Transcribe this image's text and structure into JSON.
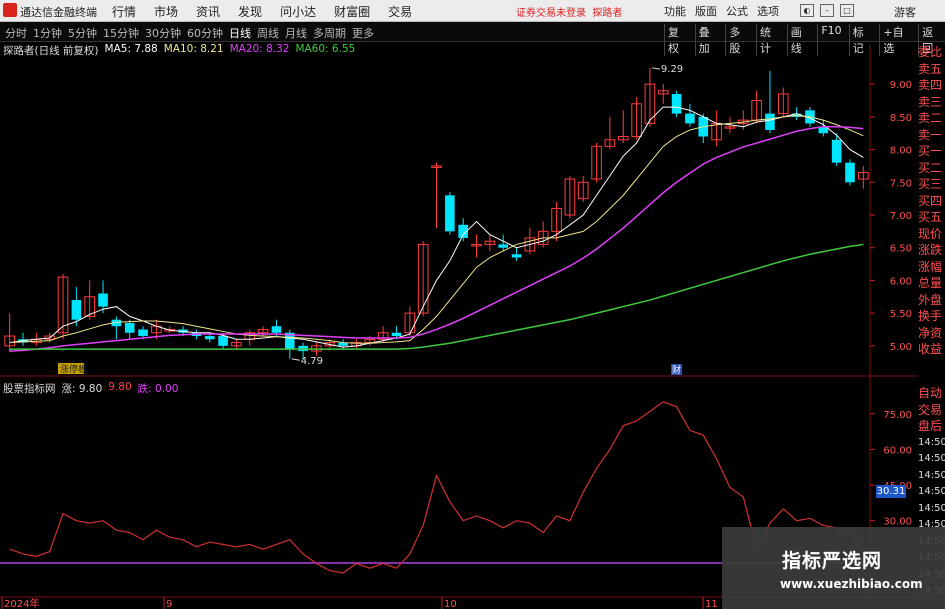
{
  "topbar": {
    "app_name": "通达信金融终端",
    "menu": [
      "行情",
      "市场",
      "资讯",
      "发现",
      "问小达",
      "财富圈",
      "交易"
    ],
    "warning": "证券交易未登录",
    "account": "探路者",
    "right_menu": [
      "功能",
      "版面",
      "公式",
      "选项"
    ],
    "guest": "游客"
  },
  "periods": {
    "items": [
      "分时",
      "1分钟",
      "5分钟",
      "15分钟",
      "30分钟",
      "60分钟",
      "日线",
      "周线",
      "月线",
      "多周期",
      "更多"
    ],
    "selected": "日线"
  },
  "tools": [
    "复权",
    "叠加",
    "多股",
    "统计",
    "画线",
    "F10",
    "标记",
    "+自选",
    "返回"
  ],
  "upper": {
    "stock_label": "探路者(日线 前复权)",
    "ma5": "MA5: 7.88",
    "ma10": "MA10: 8.21",
    "ma20": "MA20: 8.32",
    "ma60": "MA60: 6.55",
    "high_label": "9.29",
    "low_label": "4.79",
    "tag_left": "涨停板",
    "tag_mid": "财",
    "colors": {
      "up": "#ff3c3c",
      "down": "#00e5ff",
      "ma5": "#ffffff",
      "ma10": "#f0e68c",
      "ma20": "#e040fb",
      "ma60": "#3ec93e"
    }
  },
  "lower": {
    "title": "股票指标网",
    "zhang": "涨: 9.80",
    "val2": "9.80",
    "die": "跌: 0.00",
    "current_label": "30.31"
  },
  "side_panel": [
    "委比",
    "卖五",
    "卖四",
    "卖三",
    "卖二",
    "卖一",
    "买一",
    "买二",
    "买三",
    "买四",
    "买五",
    "现价",
    "涨跌",
    "涨幅",
    "总量",
    "外盘",
    "换手",
    "净资",
    "收益"
  ],
  "side_panel2": [
    "自动",
    "交易",
    "盘后",
    "14:50",
    "14:50",
    "14:50",
    "14:50",
    "14:50",
    "14:50",
    "14:50",
    "14:50",
    "14:50",
    "14:50"
  ],
  "watermark": {
    "line1": "指标严选网",
    "line2": "www.xuezhibiao.com"
  },
  "chart_data": [
    {
      "type": "candlestick",
      "y_ticks": [
        5.0,
        5.5,
        6.0,
        6.5,
        7.0,
        7.5,
        8.0,
        8.5,
        9.0
      ],
      "ylim": [
        4.6,
        9.4
      ],
      "x_tick_labels": [
        "2024年",
        "9",
        "10",
        "11"
      ],
      "candles": [
        [
          5.0,
          5.15,
          5.5,
          4.9
        ],
        [
          5.1,
          5.05,
          5.2,
          5.0
        ],
        [
          5.05,
          5.1,
          5.2,
          5.0
        ],
        [
          5.1,
          5.15,
          5.2,
          5.05
        ],
        [
          5.2,
          6.05,
          6.1,
          5.1
        ],
        [
          5.7,
          5.4,
          5.9,
          5.3
        ],
        [
          5.45,
          5.75,
          6.0,
          5.4
        ],
        [
          5.8,
          5.6,
          6.0,
          5.5
        ],
        [
          5.4,
          5.3,
          5.45,
          5.1
        ],
        [
          5.35,
          5.2,
          5.4,
          5.1
        ],
        [
          5.25,
          5.15,
          5.3,
          5.1
        ],
        [
          5.2,
          5.3,
          5.4,
          5.1
        ],
        [
          5.25,
          5.25,
          5.3,
          5.2
        ],
        [
          5.25,
          5.2,
          5.3,
          5.15
        ],
        [
          5.2,
          5.15,
          5.25,
          5.1
        ],
        [
          5.15,
          5.1,
          5.2,
          5.05
        ],
        [
          5.15,
          5.0,
          5.2,
          4.95
        ],
        [
          5.0,
          5.05,
          5.1,
          4.95
        ],
        [
          5.1,
          5.2,
          5.25,
          5.0
        ],
        [
          5.2,
          5.25,
          5.3,
          5.15
        ],
        [
          5.3,
          5.2,
          5.4,
          5.15
        ],
        [
          5.2,
          4.95,
          5.25,
          4.8
        ],
        [
          5.0,
          4.92,
          5.05,
          4.8
        ],
        [
          4.92,
          5.0,
          5.05,
          4.85
        ],
        [
          5.0,
          5.05,
          5.1,
          4.95
        ],
        [
          5.05,
          5.0,
          5.1,
          4.95
        ],
        [
          5.0,
          5.05,
          5.1,
          4.95
        ],
        [
          5.05,
          5.1,
          5.15,
          5.0
        ],
        [
          5.1,
          5.2,
          5.3,
          5.05
        ],
        [
          5.2,
          5.15,
          5.3,
          5.1
        ],
        [
          5.2,
          5.5,
          5.6,
          5.15
        ],
        [
          5.5,
          6.55,
          6.6,
          5.45
        ],
        [
          7.75,
          7.75,
          7.8,
          6.8
        ],
        [
          7.3,
          6.75,
          7.35,
          6.7
        ],
        [
          6.85,
          6.65,
          6.95,
          6.6
        ],
        [
          6.55,
          6.55,
          6.7,
          6.35
        ],
        [
          6.55,
          6.6,
          6.7,
          6.45
        ],
        [
          6.55,
          6.5,
          6.7,
          6.45
        ],
        [
          6.4,
          6.35,
          6.5,
          6.3
        ],
        [
          6.45,
          6.65,
          6.8,
          6.4
        ],
        [
          6.55,
          6.75,
          6.9,
          6.5
        ],
        [
          6.75,
          7.1,
          7.2,
          6.6
        ],
        [
          7.0,
          7.55,
          7.6,
          6.95
        ],
        [
          7.25,
          7.5,
          7.6,
          7.2
        ],
        [
          7.55,
          8.05,
          8.1,
          7.5
        ],
        [
          8.05,
          8.15,
          8.5,
          8.0
        ],
        [
          8.15,
          8.2,
          8.6,
          8.1
        ],
        [
          8.2,
          8.7,
          8.8,
          8.15
        ],
        [
          8.4,
          9.0,
          9.25,
          8.35
        ],
        [
          8.85,
          8.9,
          9.0,
          8.7
        ],
        [
          8.85,
          8.55,
          8.9,
          8.5
        ],
        [
          8.55,
          8.4,
          8.7,
          8.35
        ],
        [
          8.5,
          8.2,
          8.55,
          8.1
        ],
        [
          8.15,
          8.4,
          8.6,
          8.05
        ],
        [
          8.35,
          8.35,
          8.5,
          8.25
        ],
        [
          8.4,
          8.45,
          8.6,
          8.3
        ],
        [
          8.45,
          8.75,
          8.9,
          8.4
        ],
        [
          8.55,
          8.3,
          9.2,
          8.25
        ],
        [
          8.55,
          8.85,
          8.95,
          8.5
        ],
        [
          8.55,
          8.5,
          8.65,
          8.45
        ],
        [
          8.6,
          8.4,
          8.65,
          8.35
        ],
        [
          8.35,
          8.25,
          8.45,
          8.2
        ],
        [
          8.15,
          7.8,
          8.25,
          7.75
        ],
        [
          7.8,
          7.5,
          7.85,
          7.45
        ],
        [
          7.55,
          7.65,
          7.75,
          7.4
        ]
      ],
      "ma_series": [
        {
          "name": "MA5",
          "values": [
            5.05,
            5.08,
            5.1,
            5.12,
            5.3,
            5.37,
            5.48,
            5.56,
            5.6,
            5.45,
            5.38,
            5.3,
            5.24,
            5.22,
            5.2,
            5.2,
            5.16,
            5.1,
            5.1,
            5.12,
            5.14,
            5.12,
            5.1,
            5.06,
            5.02,
            4.98,
            5.0,
            5.04,
            5.08,
            5.12,
            5.18,
            5.6,
            6.0,
            6.3,
            6.7,
            6.9,
            6.7,
            6.6,
            6.5,
            6.55,
            6.6,
            6.7,
            6.85,
            7.0,
            7.3,
            7.6,
            7.9,
            8.1,
            8.45,
            8.65,
            8.65,
            8.6,
            8.5,
            8.4,
            8.38,
            8.35,
            8.42,
            8.45,
            8.5,
            8.55,
            8.48,
            8.38,
            8.22,
            8.0,
            7.88
          ]
        },
        {
          "name": "MA10",
          "values": [
            5.05,
            5.06,
            5.07,
            5.08,
            5.15,
            5.2,
            5.26,
            5.32,
            5.36,
            5.37,
            5.38,
            5.38,
            5.36,
            5.34,
            5.3,
            5.26,
            5.22,
            5.18,
            5.16,
            5.15,
            5.14,
            5.13,
            5.12,
            5.1,
            5.08,
            5.05,
            5.04,
            5.04,
            5.05,
            5.06,
            5.08,
            5.25,
            5.45,
            5.7,
            5.95,
            6.2,
            6.35,
            6.45,
            6.55,
            6.6,
            6.65,
            6.65,
            6.7,
            6.75,
            6.9,
            7.1,
            7.3,
            7.55,
            7.8,
            8.05,
            8.2,
            8.3,
            8.35,
            8.38,
            8.4,
            8.42,
            8.45,
            8.47,
            8.5,
            8.52,
            8.5,
            8.45,
            8.38,
            8.3,
            8.21
          ]
        },
        {
          "name": "MA20",
          "values": [
            4.92,
            4.93,
            4.95,
            4.97,
            5.0,
            5.02,
            5.04,
            5.06,
            5.08,
            5.1,
            5.12,
            5.14,
            5.16,
            5.17,
            5.18,
            5.18,
            5.18,
            5.18,
            5.18,
            5.18,
            5.18,
            5.17,
            5.16,
            5.15,
            5.14,
            5.13,
            5.12,
            5.12,
            5.12,
            5.12,
            5.13,
            5.18,
            5.25,
            5.33,
            5.42,
            5.52,
            5.62,
            5.72,
            5.82,
            5.92,
            6.02,
            6.12,
            6.22,
            6.34,
            6.48,
            6.64,
            6.8,
            6.98,
            7.16,
            7.34,
            7.5,
            7.64,
            7.78,
            7.88,
            7.96,
            8.04,
            8.1,
            8.16,
            8.22,
            8.28,
            8.32,
            8.35,
            8.35,
            8.34,
            8.32
          ]
        },
        {
          "name": "MA60",
          "values": [
            4.95,
            4.95,
            4.95,
            4.95,
            4.95,
            4.95,
            4.95,
            4.95,
            4.95,
            4.95,
            4.95,
            4.95,
            4.95,
            4.95,
            4.95,
            4.95,
            4.95,
            4.95,
            4.95,
            4.95,
            4.95,
            4.95,
            4.95,
            4.95,
            4.95,
            4.95,
            4.95,
            4.95,
            4.95,
            4.95,
            4.96,
            4.98,
            5.01,
            5.04,
            5.08,
            5.12,
            5.16,
            5.2,
            5.24,
            5.28,
            5.32,
            5.36,
            5.4,
            5.45,
            5.5,
            5.55,
            5.6,
            5.65,
            5.7,
            5.76,
            5.82,
            5.88,
            5.94,
            6.0,
            6.06,
            6.12,
            6.18,
            6.24,
            6.3,
            6.35,
            6.4,
            6.44,
            6.48,
            6.52,
            6.55
          ]
        }
      ]
    },
    {
      "type": "line",
      "y_ticks": [
        30,
        45,
        60,
        75
      ],
      "ylim": [
        0,
        85
      ],
      "series": [
        {
          "values": [
            18,
            16,
            15,
            17,
            33,
            30,
            29,
            30,
            26,
            25,
            22,
            26,
            23,
            22,
            19,
            21,
            20,
            19,
            20,
            18,
            20,
            22,
            16,
            12,
            9,
            8,
            12,
            10,
            12,
            10,
            16,
            28,
            49,
            38,
            30,
            32,
            30,
            27,
            30,
            29,
            25,
            32,
            30,
            42,
            52,
            60,
            70,
            72,
            76,
            80,
            78,
            68,
            66,
            56,
            44,
            40,
            18,
            29,
            35,
            30,
            31,
            28,
            27,
            24,
            22
          ]
        }
      ]
    }
  ]
}
